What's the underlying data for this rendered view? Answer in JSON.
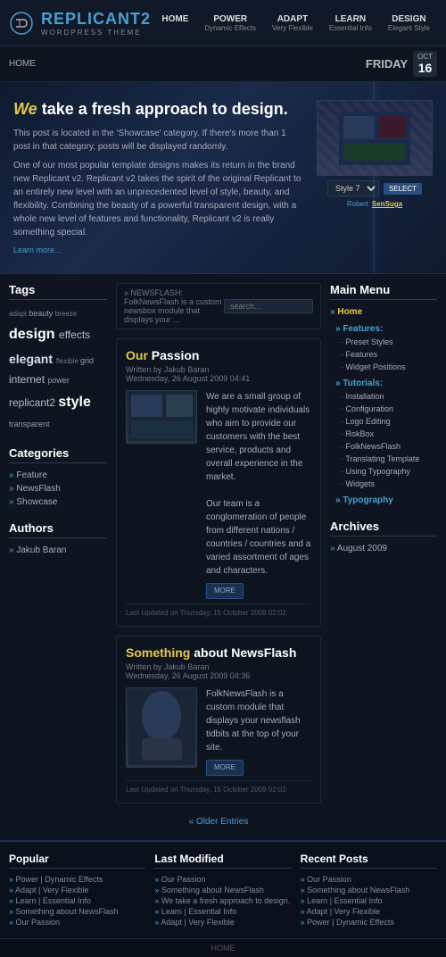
{
  "logo": {
    "title_part1": "REPLICANT",
    "title_accent": "2",
    "subtitle": "WordPress Theme"
  },
  "nav": {
    "items": [
      {
        "label": "HOME",
        "sub": ""
      },
      {
        "label": "POWER",
        "sub": "Dynamic Effects"
      },
      {
        "label": "ADAPT",
        "sub": "Very Flexible"
      },
      {
        "label": "LEARN",
        "sub": "Essential Info"
      },
      {
        "label": "DESIGN",
        "sub": "Elegant Style"
      }
    ]
  },
  "breadcrumb": {
    "text": "HOME",
    "day": "FRIDAY",
    "month": "OCT",
    "date": "16"
  },
  "hero": {
    "title_accent": "We",
    "title_rest": "take a fresh approach to design.",
    "body1": "This post is located in the 'Showcase' category. If there's more than 1 post in that category, posts will be displayed randomly.",
    "body2": "One of our most popular template designs makes its return in the brand new Replicant v2. Replicant v2 takes the spirit of the original Replicant to an entirely new level with an unprecedented level of style, beauty, and flexibility. Combining the beauty of a powerful transparent design, with a whole new level of features and functionality, Replicant v2 is really something special.",
    "learn_more": "Learn more...",
    "style_label": "Style 7",
    "select_btn": "SELECT",
    "tags": [
      "Robert",
      "SenSuga"
    ]
  },
  "search": {
    "breadcrumb": "» NEWSFLASH: FolkNewsFlash is a custom newsbox module that displays your ...",
    "placeholder": "search..."
  },
  "sidebar": {
    "tags_title": "Tags",
    "tags": [
      {
        "text": "adapt",
        "size": "small"
      },
      {
        "text": "beauty",
        "size": "medium"
      },
      {
        "text": "breeze",
        "size": "small"
      },
      {
        "text": "design",
        "size": "xlarge"
      },
      {
        "text": "effects",
        "size": "medium"
      },
      {
        "text": "elegant",
        "size": "large"
      },
      {
        "text": "flexible",
        "size": "xsmall"
      },
      {
        "text": "grid",
        "size": "small"
      },
      {
        "text": "internet",
        "size": "medium"
      },
      {
        "text": "power",
        "size": "small"
      },
      {
        "text": "replicant2",
        "size": "medium"
      },
      {
        "text": "style",
        "size": "xlarge"
      },
      {
        "text": "transparent",
        "size": "small"
      }
    ],
    "categories_title": "Categories",
    "categories": [
      "Feature",
      "NewsFlash",
      "Showcase"
    ],
    "authors_title": "Authors",
    "authors": [
      "Jakub Baran"
    ]
  },
  "posts": [
    {
      "title_accent": "Our",
      "title_rest": " Passion",
      "author": "Written by Jakub Baran",
      "date": "Wednesday, 26 August 2009 04:41",
      "body1": "We are a small group of highly motivate individuals who aim to provide our customers with the best service, products and overall experience in the market.",
      "body2": "Our team is a conglomeration of people from different nations / countries / countries and a varied assortment of ages and characters.",
      "more": "MORE",
      "updated": "Last Updated on Thursday, 15 October 2009 02:02"
    },
    {
      "title_accent": "Something",
      "title_rest": " about NewsFlash",
      "author": "Written by Jakub Baran",
      "date": "Wednesday, 26 August 2009 04:36",
      "body1": "FolkNewsFlash is a custom module that displays your newsflash tidbits at the top of your site.",
      "more": "MORE",
      "updated": "Last Updated on Thursday, 15 October 2009 02:02"
    }
  ],
  "older_entries": "Older Entries",
  "right_menu": {
    "title": "Main Menu",
    "items": [
      {
        "label": "Home",
        "type": "main"
      },
      {
        "label": "Features:",
        "type": "section"
      },
      {
        "label": "Preset Styles",
        "type": "sub"
      },
      {
        "label": "Features",
        "type": "sub"
      },
      {
        "label": "Widget Positions",
        "type": "sub"
      },
      {
        "label": "Tutorials:",
        "type": "section"
      },
      {
        "label": "Installation",
        "type": "sub"
      },
      {
        "label": "Configuration",
        "type": "sub"
      },
      {
        "label": "Logo Editing",
        "type": "sub"
      },
      {
        "label": "RokBox",
        "type": "sub"
      },
      {
        "label": "FolkNewsFlash",
        "type": "sub"
      },
      {
        "label": "Translating Template",
        "type": "sub"
      },
      {
        "label": "Using Typography",
        "type": "sub"
      },
      {
        "label": "Widgets",
        "type": "sub"
      },
      {
        "label": "Typography",
        "type": "section"
      }
    ],
    "archives_title": "Archives",
    "archives": [
      "August 2009"
    ]
  },
  "footer": {
    "columns": [
      {
        "title": "Popular",
        "links": [
          "Power | Dynamic Effects",
          "Adapt | Very Flexible",
          "Learn | Essential Info",
          "Something about NewsFlash",
          "Our Passion"
        ]
      },
      {
        "title": "Last Modified",
        "links": [
          "Our Passion",
          "Something about NewsFlash",
          "We take a fresh approach to design.",
          "Learn | Essential Info",
          "Adapt | Very Flexible"
        ]
      },
      {
        "title": "Recent Posts",
        "links": [
          "Our Passion",
          "Something about NewsFlash",
          "Learn | Essential Info",
          "Adapt | Very Flexible",
          "Power | Dynamic Effects"
        ]
      }
    ]
  },
  "bottom_bar": {
    "text": "HOME"
  }
}
